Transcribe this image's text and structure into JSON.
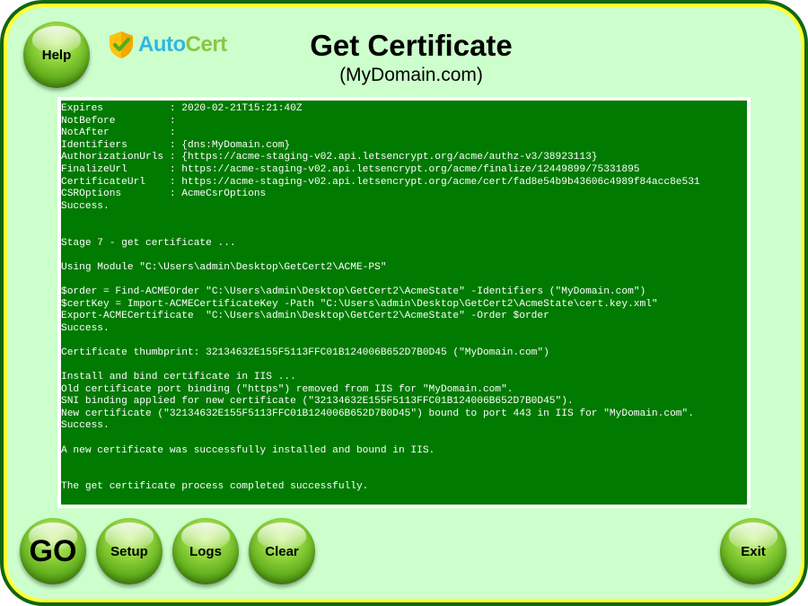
{
  "header": {
    "title": "Get Certificate",
    "subtitle": "(MyDomain.com)",
    "logo": {
      "text_part1": "Auto",
      "text_part2": "Cert",
      "icon": "shield-check-icon"
    }
  },
  "buttons": {
    "help": "Help",
    "go": "GO",
    "setup": "Setup",
    "logs": "Logs",
    "clear": "Clear",
    "exit": "Exit"
  },
  "console": {
    "lines": [
      "Expires           : 2020-02-21T15:21:40Z",
      "NotBefore         :",
      "NotAfter          :",
      "Identifiers       : {dns:MyDomain.com}",
      "AuthorizationUrls : {https://acme-staging-v02.api.letsencrypt.org/acme/authz-v3/38923113}",
      "FinalizeUrl       : https://acme-staging-v02.api.letsencrypt.org/acme/finalize/12449899/75331895",
      "CertificateUrl    : https://acme-staging-v02.api.letsencrypt.org/acme/cert/fad8e54b9b43606c4989f84acc8e531",
      "CSROptions        : AcmeCsrOptions",
      "Success.",
      "",
      "",
      "Stage 7 - get certificate ...",
      "",
      "Using Module \"C:\\Users\\admin\\Desktop\\GetCert2\\ACME-PS\"",
      "",
      "$order = Find-ACMEOrder \"C:\\Users\\admin\\Desktop\\GetCert2\\AcmeState\" -Identifiers (\"MyDomain.com\")",
      "$certKey = Import-ACMECertificateKey -Path \"C:\\Users\\admin\\Desktop\\GetCert2\\AcmeState\\cert.key.xml\"",
      "Export-ACMECertificate  \"C:\\Users\\admin\\Desktop\\GetCert2\\AcmeState\" -Order $order",
      "Success.",
      "",
      "Certificate thumbprint: 32134632E155F5113FFC01B124006B652D7B0D45 (\"MyDomain.com\")",
      "",
      "Install and bind certificate in IIS ...",
      "Old certificate port binding (\"https\") removed from IIS for \"MyDomain.com\".",
      "SNI binding applied for new certificate (\"32134632E155F5113FFC01B124006B652D7B0D45\").",
      "New certificate (\"32134632E155F5113FFC01B124006B652D7B0D45\") bound to port 443 in IIS for \"MyDomain.com\".",
      "Success.",
      "",
      "A new certificate was successfully installed and bound in IIS.",
      "",
      "",
      "The get certificate process completed successfully."
    ]
  },
  "colors": {
    "outer_border": "#116611",
    "inner_border": "#ffff33",
    "panel_bg": "#ccffcc",
    "console_bg": "#007a00",
    "console_text": "#ffffff",
    "button_green": "#5aa818"
  }
}
